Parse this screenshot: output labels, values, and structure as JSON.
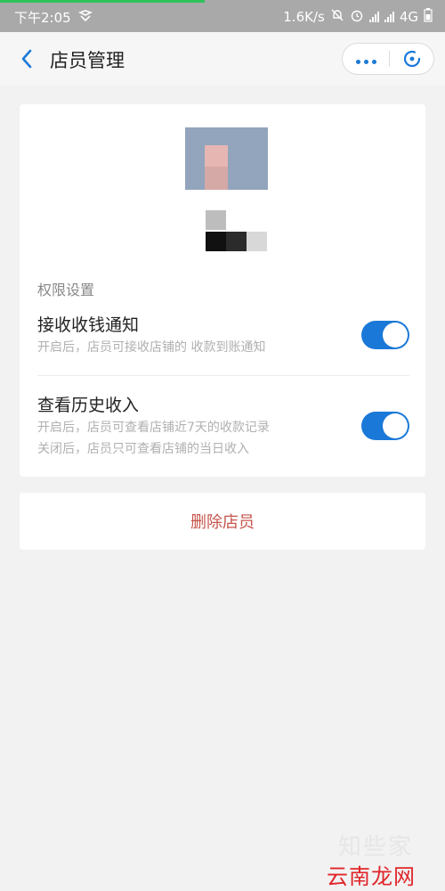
{
  "status_bar": {
    "time": "下午2:05",
    "net_speed": "1.6K/s",
    "network": "4G",
    "icons": [
      "notification-icon",
      "dnd-off-icon",
      "alarm-icon",
      "signal-icon",
      "signal-icon"
    ]
  },
  "header": {
    "title": "店员管理",
    "back_icon": "chevron-left-icon",
    "more_icon": "more-dots-icon",
    "close_icon": "mini-program-close-icon"
  },
  "profile": {
    "avatar": "blurred-avatar-image",
    "name": "pixelated-name"
  },
  "permissions": {
    "section_label": "权限设置",
    "items": [
      {
        "title": "接收收钱通知",
        "desc": [
          "开启后，店员可接收店铺的 收款到账通知"
        ],
        "enabled": true
      },
      {
        "title": "查看历史收入",
        "desc": [
          "开启后，店员可查看店铺近7天的收款记录",
          "关闭后，店员只可查看店铺的当日收入"
        ],
        "enabled": true
      }
    ]
  },
  "actions": {
    "delete_label": "删除店员"
  },
  "watermark": {
    "line1": "知些家",
    "line2": "云南龙网"
  },
  "colors": {
    "accent": "#1a79d8",
    "danger": "#c6544c",
    "page_bg": "#f2f2f2",
    "card_bg": "#ffffff"
  }
}
